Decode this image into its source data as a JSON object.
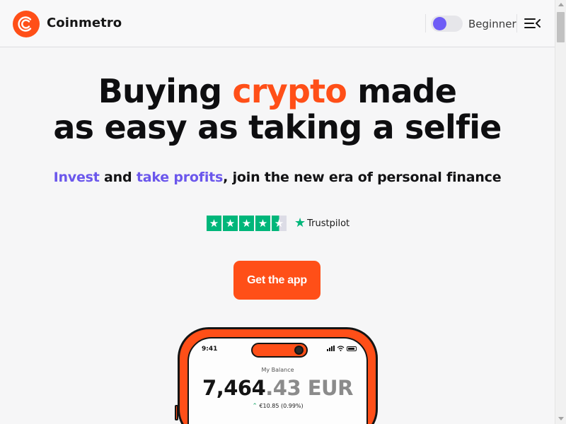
{
  "header": {
    "brand": "Coinmetro",
    "mode_label": "Beginner"
  },
  "hero": {
    "headline_1": "Buying ",
    "headline_accent": "crypto",
    "headline_2": " made",
    "headline_line2": "as easy as taking a selfie",
    "sub_invest": "Invest",
    "sub_and": " and ",
    "sub_take": "take profits",
    "sub_rest": ", join the new era of personal finance",
    "cta_label": "Get the app"
  },
  "trustpilot": {
    "name": "Trustpilot",
    "stars_filled": 4.5,
    "stars_total": 5
  },
  "phone": {
    "time": "9:41",
    "balance_label": "My Balance",
    "balance_main": "7,464",
    "balance_decimals": ".43 EUR",
    "change": "€10.85 (0.99%)"
  },
  "colors": {
    "brand_orange": "#ff4f18",
    "accent_purple": "#6b57ec",
    "trustpilot_green": "#00b67a"
  },
  "icons": [
    "coinmetro-logo",
    "menu-icon",
    "star-icon",
    "trustpilot-star-icon",
    "signal-icon",
    "wifi-icon",
    "battery-icon",
    "up-arrow-icon"
  ]
}
